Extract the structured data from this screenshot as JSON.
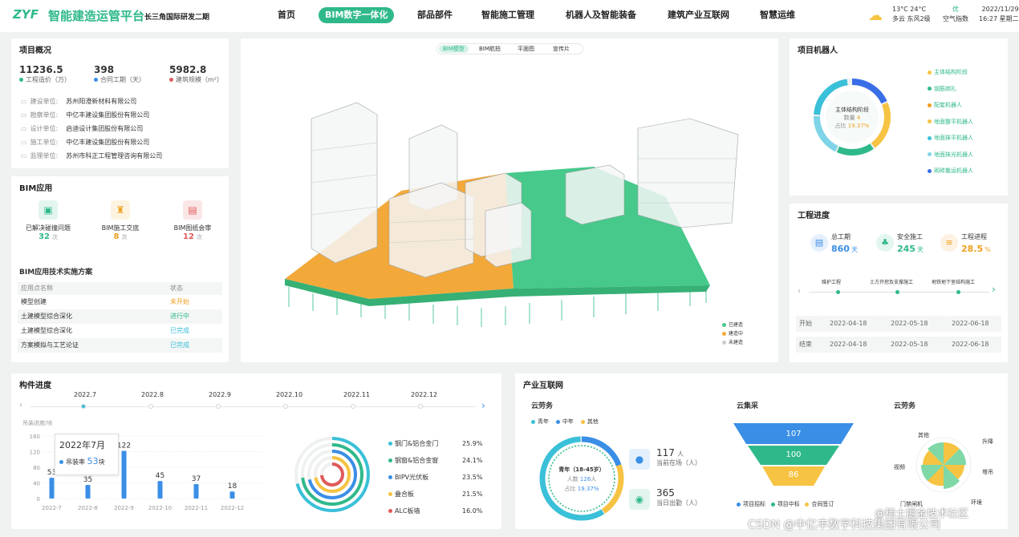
{
  "header": {
    "logo": "ZYF",
    "title": "智能建造运管平台",
    "subtitle": "长三角国际研发二期",
    "nav": [
      "首页",
      "BIM数字一体化",
      "部品部件",
      "智能施工管理",
      "机器人及智能装备",
      "建筑产业互联网",
      "智慧运维"
    ],
    "weather": {
      "temp": "13°C 24°C",
      "desc": "多云  东风2级",
      "aq_value": "优",
      "aq_label": "空气指数",
      "date": "2022/11/29",
      "time": "16:27 星期二"
    }
  },
  "overview": {
    "title": "项目概况",
    "stats": [
      {
        "value": "11236.5",
        "label": "工程造价（万）",
        "color": "#2fb98a"
      },
      {
        "value": "398",
        "label": "合同工期（天）",
        "color": "#3a8ee6"
      },
      {
        "value": "5982.8",
        "label": "建筑规模（m²）",
        "color": "#e05a5a"
      }
    ],
    "rows": [
      {
        "k": "建设单位:",
        "v": "苏州阳澄新材料有限公司"
      },
      {
        "k": "勘察单位:",
        "v": "中亿丰建设集团股份有限公司"
      },
      {
        "k": "设计单位:",
        "v": "启迪设计集团股份有限公司"
      },
      {
        "k": "施工单位:",
        "v": "中亿丰建设集团股份有限公司"
      },
      {
        "k": "监理单位:",
        "v": "苏州市科正工程管理咨询有限公司"
      }
    ]
  },
  "bim": {
    "title": "BIM应用",
    "apps": [
      {
        "label": "已解决碰撞问题",
        "value": "32",
        "unit": "次",
        "color": "#2fb98a",
        "bg": "#e3f5ef"
      },
      {
        "label": "BIM施工交底",
        "value": "8",
        "unit": "次",
        "color": "#f0a020",
        "bg": "#fdf3e0"
      },
      {
        "label": "BIM图纸会审",
        "value": "12",
        "unit": "次",
        "color": "#e05a5a",
        "bg": "#fbe6e6"
      }
    ],
    "plan_title": "BIM应用技术实施方案",
    "col1": "应用点名称",
    "col2": "状态",
    "plans": [
      {
        "name": "模型创建",
        "status": "未开始",
        "color": "#f0a020"
      },
      {
        "name": "土建模型综合深化",
        "status": "进行中",
        "color": "#2fb98a"
      },
      {
        "name": "土建模型综合深化",
        "status": "已完成",
        "color": "#3ac0d8"
      },
      {
        "name": "方案模拟与工艺论证",
        "status": "已完成",
        "color": "#3ac0d8"
      }
    ]
  },
  "viewer": {
    "tabs": [
      "BIM模型",
      "BIM航拍",
      "平面图",
      "宣传片"
    ],
    "legend": [
      "已建造",
      "建造中",
      "未建造"
    ]
  },
  "robots": {
    "title": "项目机器人",
    "center_title": "主体结构阶段",
    "count_label": "数量",
    "count": "4",
    "pct_label": "占比",
    "pct": "19.37%",
    "legend": [
      {
        "name": "主体结构阶段",
        "color": "#f6c342"
      },
      {
        "name": "钢筋绑扎",
        "color": "#2fb98a"
      },
      {
        "name": "配套机器人",
        "color": "#f0a020"
      },
      {
        "name": "地面整平机器人",
        "color": "#f6c342"
      },
      {
        "name": "地面抹平机器人",
        "color": "#3ac0d8"
      },
      {
        "name": "地面抹光机器人",
        "color": "#7fd4e8"
      },
      {
        "name": "砌砖搬运机器人",
        "color": "#3a6ee6"
      }
    ]
  },
  "progress": {
    "title": "工程进度",
    "items": [
      {
        "label": "总工期",
        "value": "860",
        "unit": "天",
        "color": "#3a8ee6"
      },
      {
        "label": "安全施工",
        "value": "245",
        "unit": "天",
        "color": "#2fb98a"
      },
      {
        "label": "工程进程",
        "value": "28.5",
        "unit": "%",
        "color": "#f0a020"
      }
    ],
    "steps": [
      "维护工程",
      "土方开挖及支撑施工",
      "地铁地下室结构施工"
    ],
    "start_label": "开始",
    "start": [
      "2022-04-18",
      "2022-05-18",
      "2022-06-18"
    ],
    "end_label": "结束",
    "end": [
      "2022-04-18",
      "2022-05-18",
      "2022-06-18"
    ]
  },
  "components": {
    "title": "构件进度",
    "months": [
      "2022.7",
      "2022.8",
      "2022.9",
      "2022.10",
      "2022.11",
      "2022.12"
    ],
    "ylabel": "吊装进度/块",
    "tooltip_month": "2022年7月",
    "tooltip_label": "吊装率",
    "tooltip_value": "53",
    "tooltip_unit": "块",
    "legend": [
      {
        "name": "钢门&铝合金门",
        "pct": "25.9%",
        "color": "#3ac0d8"
      },
      {
        "name": "钢窗&铝合金窗",
        "pct": "24.1%",
        "color": "#2fb98a"
      },
      {
        "name": "BIPV光伏板",
        "pct": "23.5%",
        "color": "#3a8ee6"
      },
      {
        "name": "叠合板",
        "pct": "21.5%",
        "color": "#f6c342"
      },
      {
        "name": "ALC板墙",
        "pct": "16.0%",
        "color": "#e05a5a"
      }
    ]
  },
  "chart_data": {
    "type": "bar",
    "categories": [
      "2022-7",
      "2022-8",
      "2022-9",
      "2022-10",
      "2022-11",
      "2022-12"
    ],
    "values": [
      53,
      35,
      122,
      45,
      37,
      18
    ],
    "ylim": [
      0,
      160
    ],
    "yticks": [
      0,
      40,
      80,
      120,
      160
    ],
    "ylabel": "吊装进度/块"
  },
  "industry": {
    "title": "产业互联网",
    "labor_title": "云劳务",
    "labor_legend": [
      {
        "name": "青年",
        "color": "#3ac0d8"
      },
      {
        "name": "中年",
        "color": "#3a8ee6"
      },
      {
        "name": "其他",
        "color": "#f6c342"
      }
    ],
    "ring_title": "青年（18-45岁）",
    "ring_count_label": "人数",
    "ring_count": "126",
    "ring_count_unit": "人",
    "ring_pct_label": "占比",
    "ring_pct": "19.37%",
    "onsite_value": "117",
    "onsite_unit": "人",
    "onsite_label": "当前在场（人）",
    "today_value": "365",
    "today_label": "当日出勤（人）",
    "procure_title": "云集采",
    "funnel": [
      "107",
      "100",
      "86"
    ],
    "funnel_legend": [
      {
        "name": "项目招标",
        "color": "#3a8ee6"
      },
      {
        "name": "项目中标",
        "color": "#2fb98a"
      },
      {
        "name": "合同签订",
        "color": "#f6c342"
      }
    ],
    "rose_title": "云劳务",
    "rose_labels": [
      "其他",
      "升降",
      "视频",
      "塔吊",
      "门禁闸机",
      "环境"
    ]
  },
  "watermark": "CSDN @中亿丰数字科技集团有限公司",
  "watermark2": "@稀土掘金技术社区"
}
